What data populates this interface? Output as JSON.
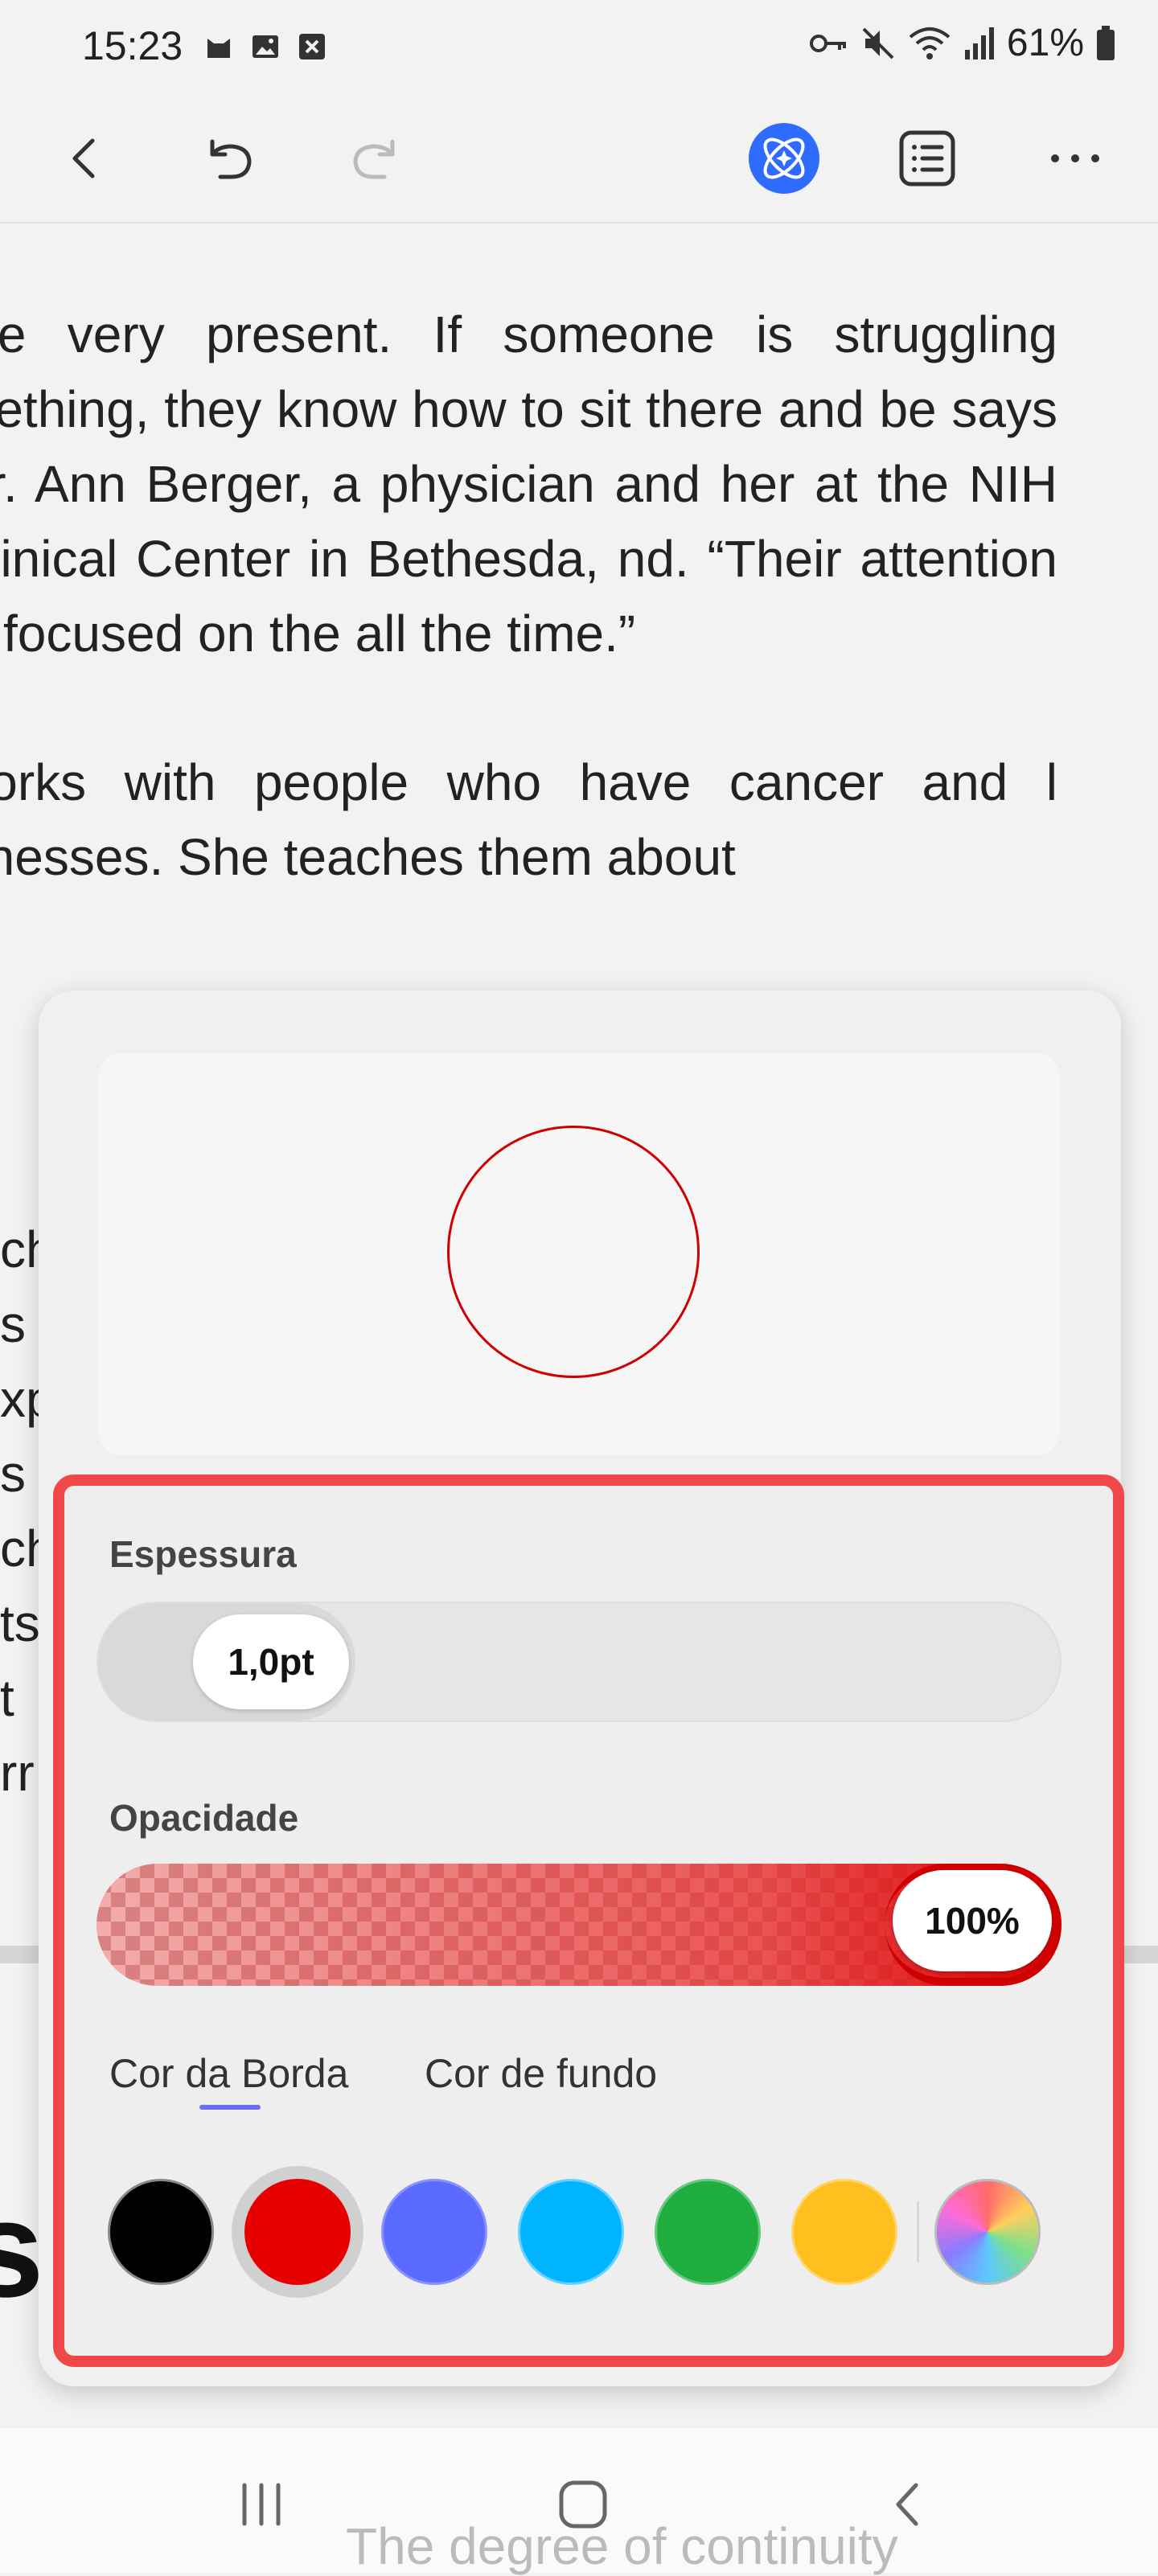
{
  "status_bar": {
    "time": "15:23",
    "battery": "61%",
    "left_icons": [
      "cat-icon",
      "image-icon",
      "close-box-icon"
    ],
    "right_icons": [
      "key-icon",
      "mute-icon",
      "wifi-icon",
      "signal-icon",
      "battery-icon"
    ]
  },
  "toolbar": {
    "buttons": [
      "back-icon",
      "undo-icon",
      "redo-icon",
      "assistant-icon",
      "list-icon",
      "more-icon"
    ]
  },
  "article": {
    "paragraphs": [
      "are very present. If someone is struggling mething, they know how to sit there and be says Dr. Ann Berger, a physician and her at the NIH Clinical Center in Bethesda, nd. “Their attention is focused on the all the time.”",
      "works with people who have cancer and l illnesses. She teaches them about"
    ],
    "tail_lines": [
      "ch",
      "s",
      "xp",
      "s",
      "ch",
      "ts",
      "t",
      "rr"
    ],
    "heading_fragment": "st",
    "bottom_text": "The degree of continuity"
  },
  "panel": {
    "thickness_label": "Espessura",
    "thickness_value": "1,0pt",
    "opacity_label": "Opacidade",
    "opacity_value": "100%",
    "opacity_level": 1.0,
    "tabs": [
      {
        "label": "Cor da Borda",
        "active": true
      },
      {
        "label": "Cor de fundo",
        "active": false
      }
    ],
    "colors": [
      "#000000",
      "#e60000",
      "#5b6bff",
      "#00b4ff",
      "#1fae3f",
      "#ffbf1e",
      "multicolor"
    ],
    "selected_color": "#e60000",
    "preview_stroke_color": "#d00000",
    "highlight_color": "#f04848"
  },
  "navbar": {
    "buttons": [
      "recents-icon",
      "home-icon",
      "back-nav-icon"
    ]
  }
}
